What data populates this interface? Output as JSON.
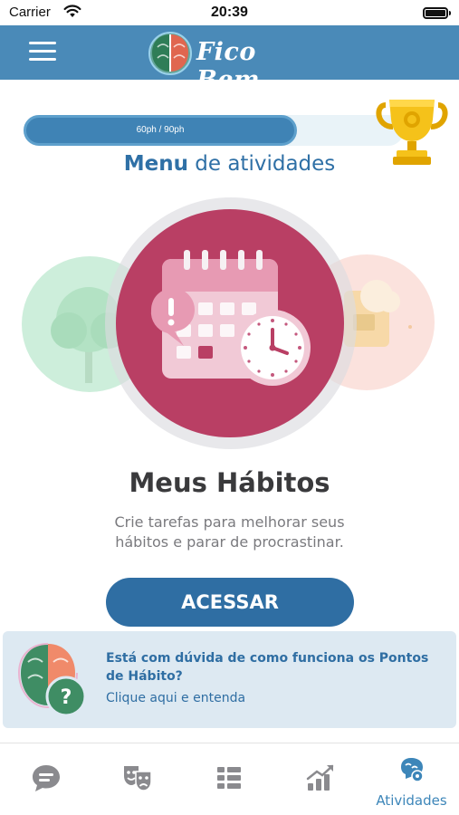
{
  "status_bar": {
    "carrier": "Carrier",
    "time": "20:39"
  },
  "header": {
    "app_name": "Fico Bem",
    "menu_icon": "hamburger-menu-icon"
  },
  "progress": {
    "label": "60ph / 90ph",
    "current": 60,
    "max": 90,
    "fraction": 0.6667,
    "trophy_icon": "trophy-icon"
  },
  "menu_title": {
    "bold": "Menu",
    "rest": " de atividades"
  },
  "carousel": {
    "prev_icon": "tree-icon",
    "current_icon": "calendar-clock-icon",
    "next_icon": "clipboard-icon"
  },
  "activity": {
    "title": "Meus Hábitos",
    "description": "Crie tarefas para melhorar seus hábitos e parar de procrastinar.",
    "button_label": "ACESSAR"
  },
  "help": {
    "title": "Está com dúvida de como funciona os Pontos de Hábito?",
    "link": "Clique aqui e entenda"
  },
  "tabbar": {
    "tabs": [
      {
        "icon": "chat-icon",
        "label": ""
      },
      {
        "icon": "theater-masks-icon",
        "label": ""
      },
      {
        "icon": "list-icon",
        "label": ""
      },
      {
        "icon": "chart-growth-icon",
        "label": ""
      },
      {
        "icon": "brain-activities-icon",
        "label": "Atividades"
      }
    ],
    "active_index": 4
  },
  "colors": {
    "header": "#4a8ab8",
    "primary": "#2f6ea3",
    "activity_circle": "#b93f64",
    "left_circle": "#cdeedb",
    "right_circle": "#fbe2dd",
    "help_card": "#dde9f2"
  }
}
